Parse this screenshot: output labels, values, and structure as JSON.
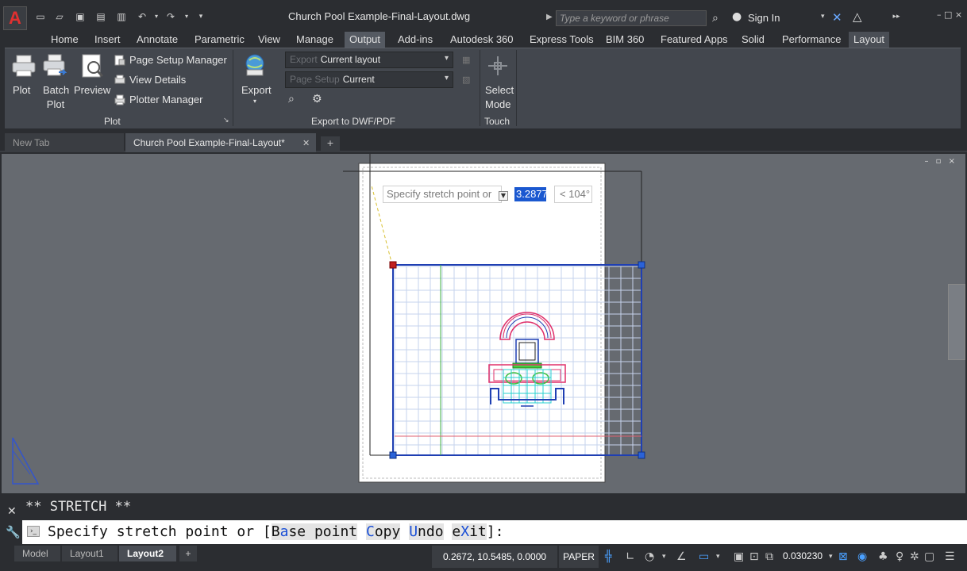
{
  "titlebar": {
    "app_logo": "A",
    "doc_title": "Church Pool Example-Final-Layout.dwg",
    "search_placeholder": "Type a keyword or phrase",
    "signin": "Sign In"
  },
  "ribbon": {
    "tabs": [
      "Home",
      "Insert",
      "Annotate",
      "Parametric",
      "View",
      "Manage",
      "Output",
      "Add-ins",
      "Autodesk 360",
      "Express Tools",
      "BIM 360",
      "Featured Apps",
      "Solid",
      "Performance",
      "Layout"
    ],
    "active_tab": "Output",
    "plot_panel": {
      "title": "Plot",
      "plot": "Plot",
      "batch_plot_1": "Batch",
      "batch_plot_2": "Plot",
      "preview": "Preview",
      "page_setup_manager": "Page Setup Manager",
      "view_details": "View Details",
      "plotter_manager": "Plotter Manager"
    },
    "export_panel": {
      "title": "Export to DWF/PDF",
      "export": "Export",
      "export_combo_label": "Export",
      "export_combo_value": "Current layout",
      "page_setup_label": "Page Setup",
      "page_setup_value": "Current"
    },
    "touch_panel": {
      "title": "Touch",
      "select_mode_1": "Select",
      "select_mode_2": "Mode"
    }
  },
  "doc_tabs": {
    "new_tab": "New Tab",
    "active_doc": "Church Pool Example-Final-Layout*"
  },
  "dynamic_input": {
    "prompt": "Specify stretch point or",
    "value": "3.2877",
    "angle": "< 104°"
  },
  "command": {
    "history": "** STRETCH **",
    "prompt_prefix": "Specify stretch point or [",
    "opt1_pre": "B",
    "opt1_hot": "a",
    "opt1_post": "se point",
    "opt2_hot": "C",
    "opt2_post": "opy",
    "opt3_hot": "U",
    "opt3_post": "ndo",
    "opt4_pre": "e",
    "opt4_hot": "X",
    "opt4_post": "it",
    "prompt_suffix": "]:"
  },
  "status": {
    "layout_tabs": [
      "Model",
      "Layout1",
      "Layout2"
    ],
    "active_layout": "Layout2",
    "coordinates": "0.2672, 10.5485, 0.0000",
    "space": "PAPER",
    "scale": "0.030230"
  },
  "colors": {
    "drawing_bg": "#666a70",
    "paper": "#ffffff",
    "grid_blue": "#9fb7e0",
    "viewport_blue": "#1f3fb3",
    "pink": "#e0306a",
    "cyan": "#28d0d0",
    "green": "#40c040"
  }
}
